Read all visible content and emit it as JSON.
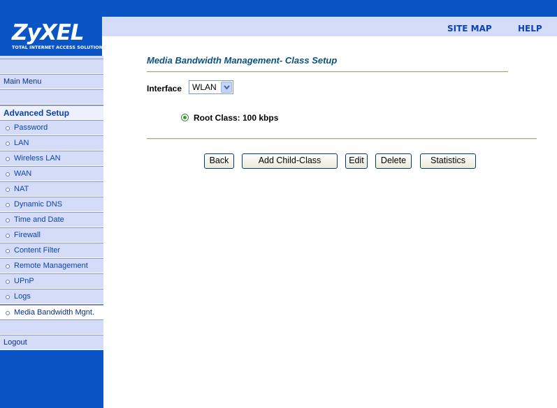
{
  "brand": {
    "logo_text": "ZyXEL",
    "tagline": "TOTAL INTERNET ACCESS SOLUTION"
  },
  "header": {
    "site_map": "SITE MAP",
    "help": "HELP"
  },
  "sidebar": {
    "main_menu": "Main Menu",
    "section": "Advanced Setup",
    "items": [
      {
        "label": "Password"
      },
      {
        "label": "LAN"
      },
      {
        "label": "Wireless LAN"
      },
      {
        "label": "WAN"
      },
      {
        "label": "NAT"
      },
      {
        "label": "Dynamic DNS"
      },
      {
        "label": "Time and Date"
      },
      {
        "label": "Firewall"
      },
      {
        "label": "Content Filter"
      },
      {
        "label": "Remote Management"
      },
      {
        "label": "UPnP"
      },
      {
        "label": "Logs"
      },
      {
        "label": "Media Bandwidth Mgnt."
      }
    ],
    "active_item": "Media Bandwidth Mgnt.",
    "logout": "Logout"
  },
  "main": {
    "title": "Media Bandwidth Management- Class Setup",
    "interface_label": "Interface",
    "interface_value": "WLAN",
    "root_class_label": "Root Class: 100 kbps",
    "buttons": {
      "back": "Back",
      "add_child": "Add Child-Class",
      "edit": "Edit",
      "delete": "Delete",
      "statistics": "Statistics"
    }
  },
  "colors": {
    "brand_blue": "#0a55c6",
    "sidebar_bg": "#d5dcf8",
    "link": "#0a43b4",
    "title": "#0a5080"
  }
}
